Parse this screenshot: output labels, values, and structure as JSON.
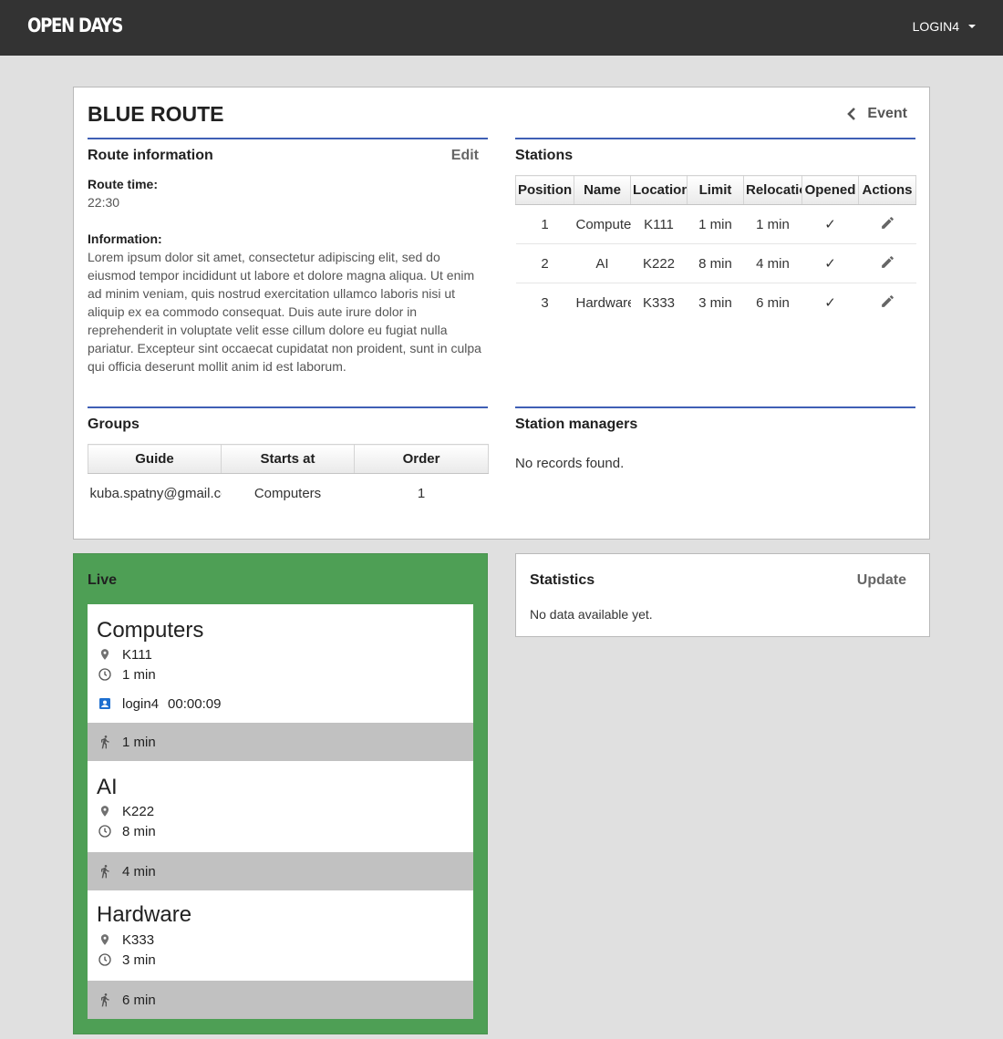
{
  "app": {
    "logo": "OPEN DAYS",
    "user": "LOGIN4"
  },
  "route": {
    "title": "BLUE ROUTE",
    "back_label": "Event"
  },
  "route_info": {
    "title": "Route information",
    "edit_label": "Edit",
    "time_label": "Route time:",
    "time_value": "22:30",
    "info_label": "Information:",
    "info_lines": [
      "Lorem ipsum dolor sit amet, consectetur adipiscing elit, sed do",
      "eiusmod tempor incididunt ut labore et dolore magna aliqua. Ut enim",
      "ad minim veniam, quis nostrud exercitation ullamco laboris nisi ut",
      "aliquip ex ea commodo consequat. Duis aute irure dolor in",
      "reprehenderit in voluptate velit esse cillum dolore eu fugiat nulla",
      "pariatur. Excepteur sint occaecat cupidatat non proident, sunt in culpa",
      "qui officia deserunt mollit anim id est laborum."
    ]
  },
  "stations": {
    "title": "Stations",
    "columns": [
      "Position",
      "Name",
      "Location",
      "Limit",
      "Relocation",
      "Opened",
      "Actions"
    ],
    "rows": [
      {
        "position": "1",
        "name": "Computers",
        "location": "K111",
        "limit": "1 min",
        "relocation": "1 min",
        "opened": "✓"
      },
      {
        "position": "2",
        "name": "AI",
        "location": "K222",
        "limit": "8 min",
        "relocation": "4 min",
        "opened": "✓"
      },
      {
        "position": "3",
        "name": "Hardware",
        "location": "K333",
        "limit": "3 min",
        "relocation": "6 min",
        "opened": "✓"
      }
    ]
  },
  "groups": {
    "title": "Groups",
    "columns": [
      "Guide",
      "Starts at",
      "Order"
    ],
    "rows": [
      {
        "guide": "kuba.spatny@gmail.com",
        "starts_at": "Computers",
        "order": "1"
      }
    ]
  },
  "station_managers": {
    "title": "Station managers",
    "empty": "No records found."
  },
  "live": {
    "title": "Live",
    "stations": [
      {
        "name": "Computers",
        "location": "K111",
        "limit": "1 min",
        "guide": "login4",
        "timer": "00:00:09",
        "walk": "1 min"
      },
      {
        "name": "AI",
        "location": "K222",
        "limit": "8 min",
        "walk": "4 min"
      },
      {
        "name": "Hardware",
        "location": "K333",
        "limit": "3 min",
        "walk": "6 min"
      }
    ]
  },
  "statistics": {
    "title": "Statistics",
    "update_label": "Update",
    "empty": "No data available yet."
  },
  "colors": {
    "topbar": "#333333",
    "accent": "#3f5fb5",
    "live_green": "#4e9f55",
    "walk_gray": "#c1c1c1",
    "user_icon": "#1e6fd0"
  }
}
